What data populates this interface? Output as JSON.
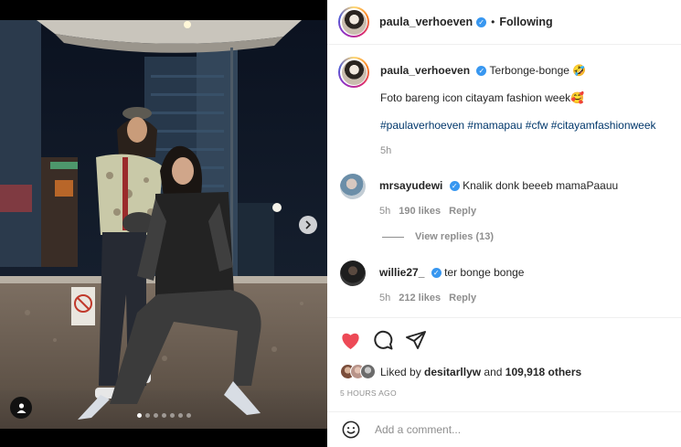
{
  "header": {
    "username": "paula_verhoeven",
    "separator": "•",
    "follow_status": "Following"
  },
  "caption": {
    "username": "paula_verhoeven",
    "title": "Terbonge-bonge 🤣",
    "text": "Foto bareng icon citayam fashion week🥰",
    "hashtags": "#paulaverhoeven #mamapau #cfw #citayamfashionweek",
    "time": "5h"
  },
  "comments": [
    {
      "username": "mrsayudewi",
      "text": "Knalik donk beeeb mamaPaauu",
      "time": "5h",
      "likes": "190 likes",
      "reply": "Reply"
    },
    {
      "username": "willie27_",
      "text": "ter bonge bonge",
      "time": "5h",
      "likes": "212 likes",
      "reply": "Reply"
    }
  ],
  "view_replies": "View replies (13)",
  "likes": {
    "prefix": "Liked by",
    "user": "desitarllyw",
    "joiner": "and",
    "others": "109,918 others"
  },
  "post_time": "5 HOURS AGO",
  "add_comment": {
    "placeholder": "Add a comment..."
  },
  "carousel": {
    "total": 7,
    "active": 0
  },
  "colors": {
    "like_red": "#ed4956",
    "link_blue": "#00376b",
    "verified_blue": "#3897f0",
    "meta_gray": "#8e8e8e"
  },
  "icons": [
    "heart-icon",
    "comment-icon",
    "share-icon",
    "emoji-icon",
    "tag-user-icon",
    "chevron-right-icon",
    "verified-badge-icon"
  ]
}
